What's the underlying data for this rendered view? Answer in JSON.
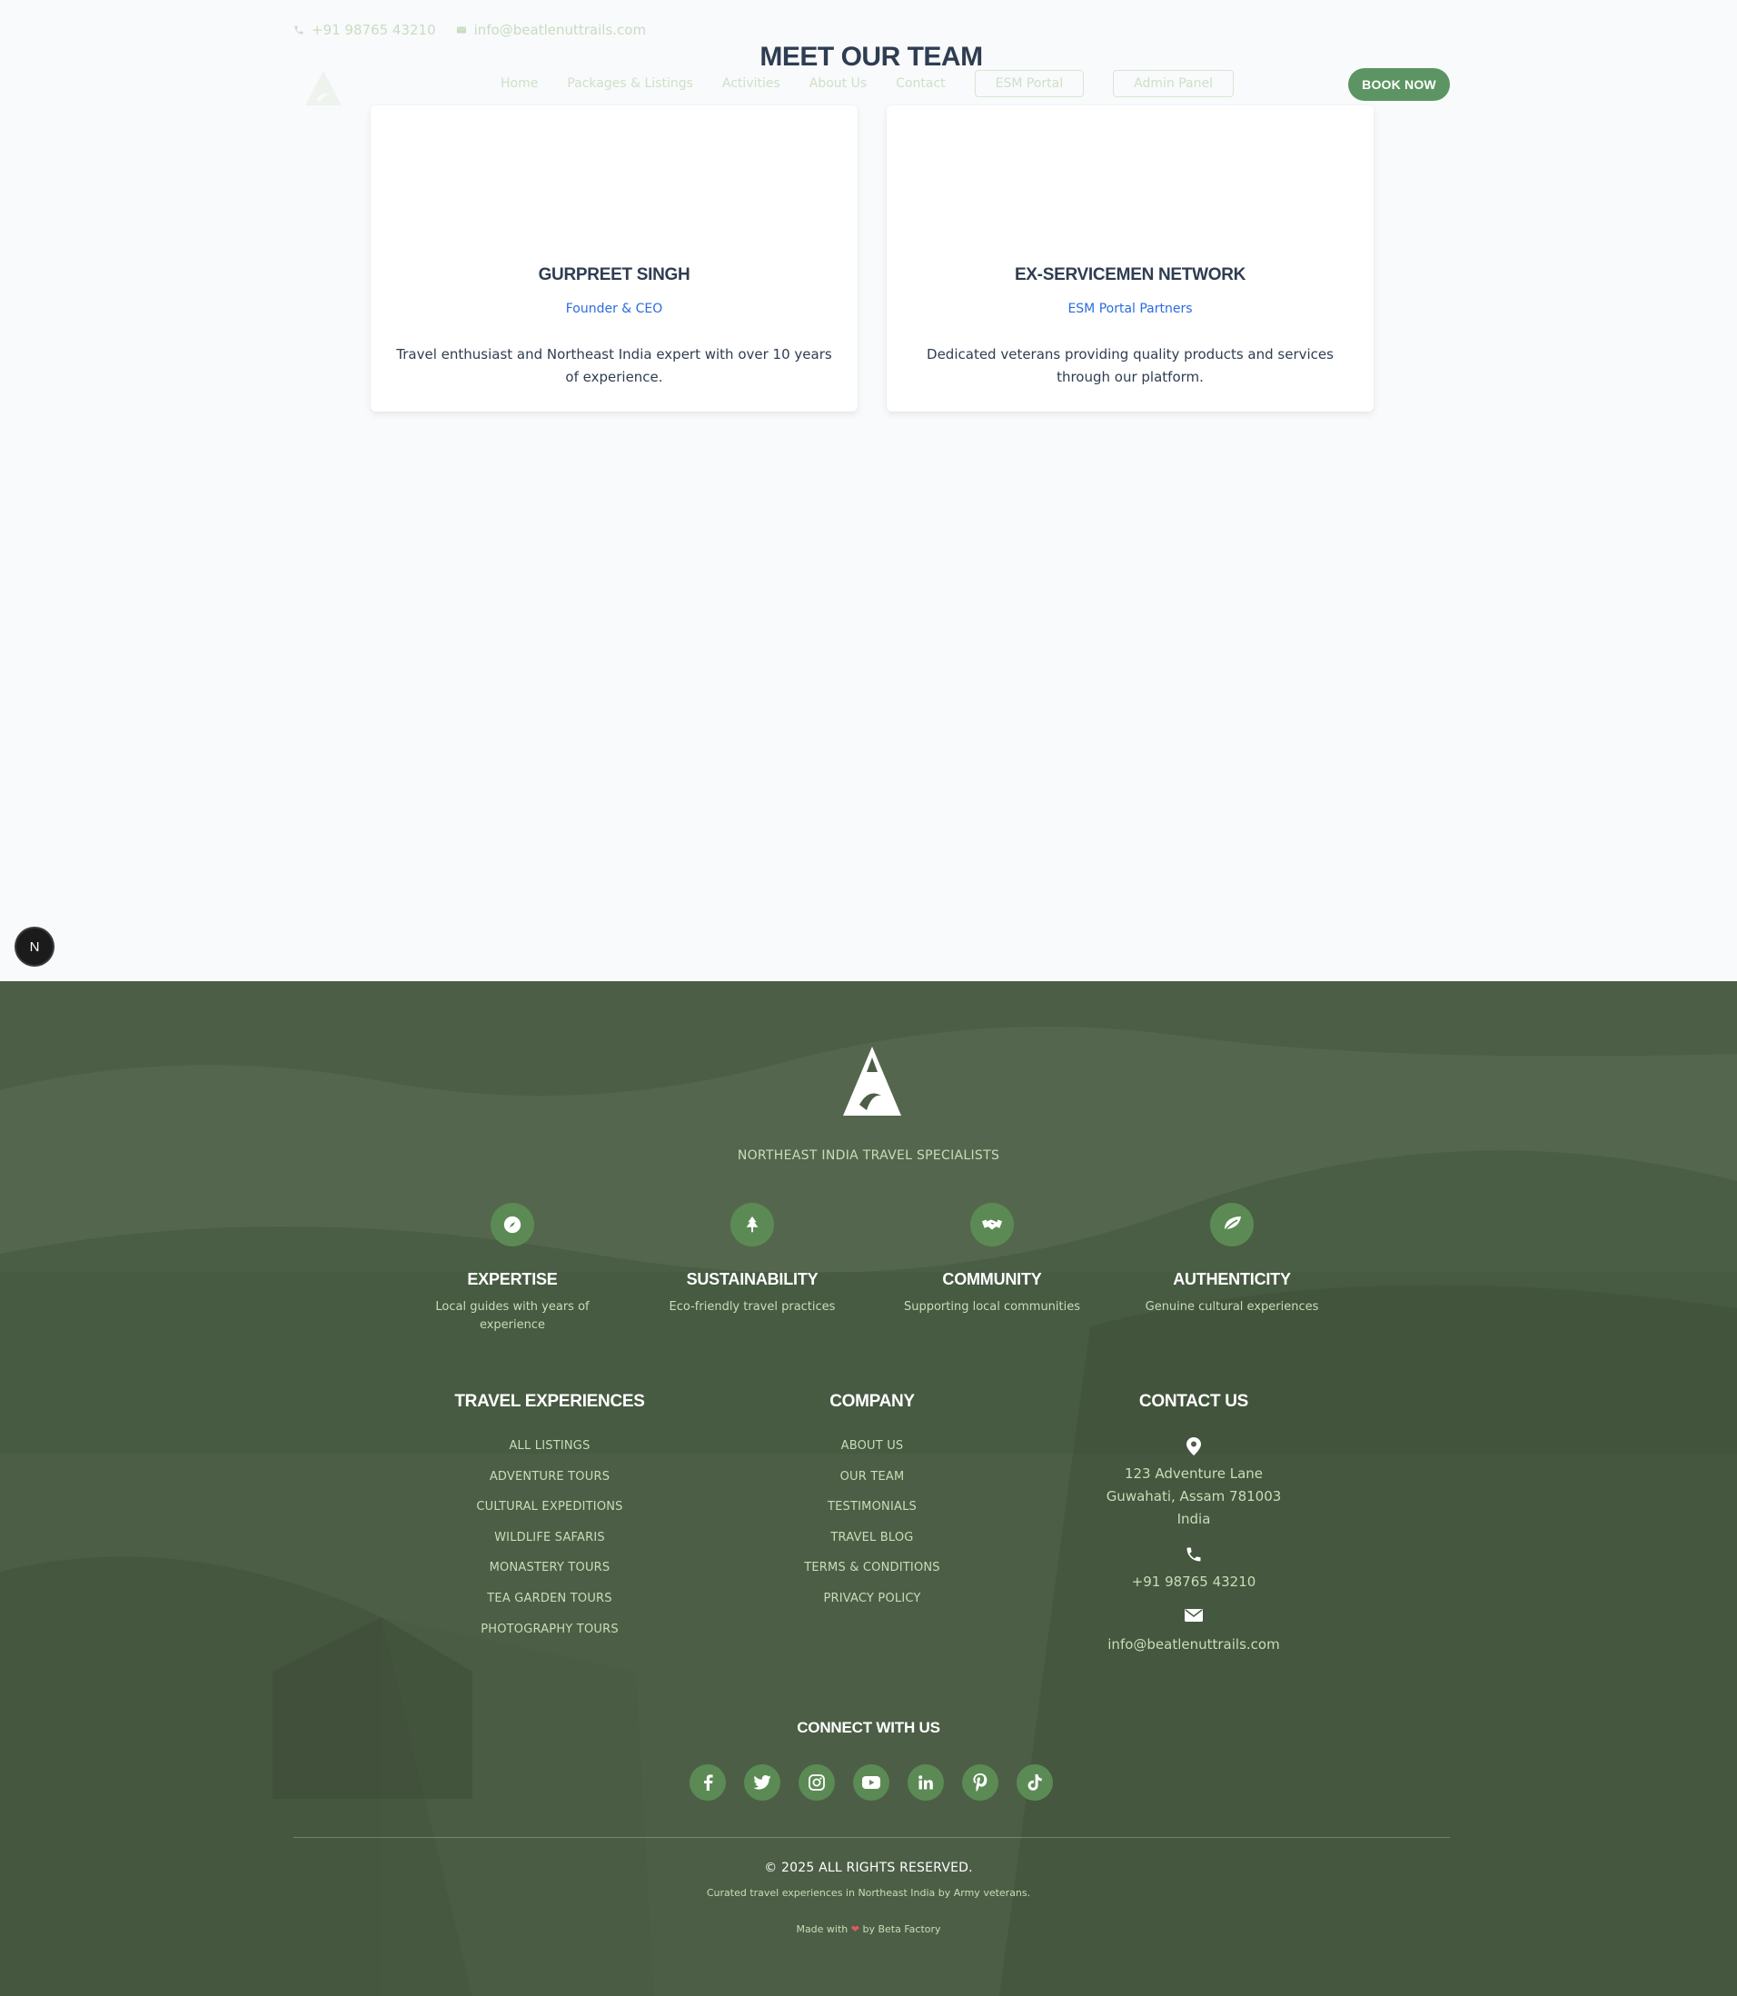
{
  "header": {
    "phone": "+91 98765 43210",
    "email": "info@beatlenuttrails.com",
    "nav": {
      "home": "Home",
      "packages": "Packages & Listings",
      "activities": "Activities",
      "about": "About Us",
      "contact": "Contact",
      "esm_portal": "ESM Portal",
      "admin_panel": "Admin Panel"
    },
    "book_now": "BOOK NOW"
  },
  "team": {
    "title": "MEET OUR TEAM",
    "members": [
      {
        "name": "GURPREET SINGH",
        "role": "Founder & CEO",
        "bio": "Travel enthusiast and Northeast India expert with over 10 years of experience."
      },
      {
        "name": "EX-SERVICEMEN NETWORK",
        "role": "ESM Portal Partners",
        "bio": "Dedicated veterans providing quality products and services through our platform."
      }
    ]
  },
  "dev_badge": "N",
  "footer": {
    "tagline": "NORTHEAST INDIA TRAVEL SPECIALISTS",
    "values": [
      {
        "icon": "compass-icon",
        "title": "EXPERTISE",
        "desc": "Local guides with years of experience"
      },
      {
        "icon": "tree-icon",
        "title": "SUSTAINABILITY",
        "desc": "Eco-friendly travel practices"
      },
      {
        "icon": "handshake-icon",
        "title": "COMMUNITY",
        "desc": "Supporting local communities"
      },
      {
        "icon": "leaf-icon",
        "title": "AUTHENTICITY",
        "desc": "Genuine cultural experiences"
      }
    ],
    "travel": {
      "heading": "TRAVEL EXPERIENCES",
      "links": [
        "ALL LISTINGS",
        "ADVENTURE TOURS",
        "CULTURAL EXPEDITIONS",
        "WILDLIFE SAFARIS",
        "MONASTERY TOURS",
        "TEA GARDEN TOURS",
        "PHOTOGRAPHY TOURS"
      ]
    },
    "company": {
      "heading": "COMPANY",
      "links": [
        "ABOUT US",
        "OUR TEAM",
        "TESTIMONIALS",
        "TRAVEL BLOG",
        "TERMS & CONDITIONS",
        "PRIVACY POLICY"
      ]
    },
    "contact": {
      "heading": "CONTACT US",
      "address_line1": "123 Adventure Lane",
      "address_line2": "Guwahati, Assam 781003",
      "address_line3": "India",
      "phone": "+91 98765 43210",
      "email": "info@beatlenuttrails.com"
    },
    "connect": "CONNECT WITH US",
    "socials": [
      "facebook-icon",
      "twitter-icon",
      "instagram-icon",
      "youtube-icon",
      "linkedin-icon",
      "pinterest-icon",
      "tiktok-icon"
    ],
    "copyright": "© 2025 ALL RIGHTS RESERVED.",
    "curated": "Curated travel experiences in Northeast India by Army veterans.",
    "made_prefix": "Made with",
    "made_suffix": "by Beta Factory"
  },
  "colors": {
    "accent": "#5c9563",
    "footer_bg": "#4b5e45",
    "link_blue": "#2b6be0",
    "heading_dark": "#2f3d51"
  }
}
